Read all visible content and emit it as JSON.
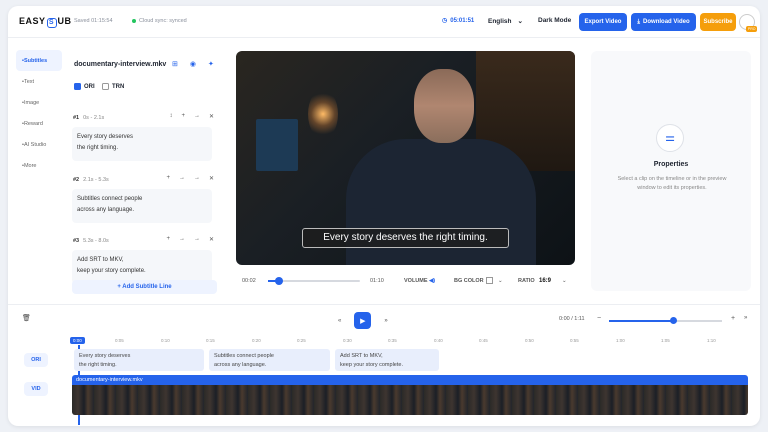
{
  "topbar": {
    "logo_left": "EASY",
    "logo_mark": "S",
    "logo_right": "UB",
    "saved": "Saved 01:15:54",
    "cloud": "Cloud sync: synced",
    "timer": "05:01:51",
    "language": "English",
    "dark_mode": "Dark Mode",
    "export": "Export Video",
    "download": "Download Video",
    "subscribe": "Subscribe",
    "avatar_badge": "PRO"
  },
  "sidebar": {
    "items": [
      {
        "label": "Subtitles"
      },
      {
        "label": "Text"
      },
      {
        "label": "Image"
      },
      {
        "label": "Reward"
      },
      {
        "label": "AI Studio"
      },
      {
        "label": "More"
      }
    ]
  },
  "panel": {
    "filename": "documentary-interview.mkv",
    "ori": "ORI",
    "trn": "TRN",
    "subs": [
      {
        "num": "#1",
        "time": "0s - 2.1s",
        "line1": "Every story deserves",
        "line2": "the right timing."
      },
      {
        "num": "#2",
        "time": "2.1s - 5.3s",
        "line1": "Subtitles connect people",
        "line2": "across any language."
      },
      {
        "num": "#3",
        "time": "5.3s - 8.0s",
        "line1": "Add SRT to MKV,",
        "line2": "keep your story complete."
      }
    ],
    "add_line": "+ Add Subtitle Line"
  },
  "video": {
    "caption": "Every story deserves the right timing."
  },
  "controls": {
    "current": "00:02",
    "duration": "01:10",
    "volume": "VOLUME",
    "bg_color": "BG COLOR",
    "ratio_label": "RATIO",
    "ratio_value": "16:9",
    "progress": 0.03
  },
  "properties": {
    "title": "Properties",
    "description": "Select a clip on the timeline or in the preview window to edit its properties."
  },
  "timeline": {
    "time": "0:00 / 1:11",
    "zoom": 0.58,
    "ruler": [
      "0:00",
      "0:05",
      "0:10",
      "0:15",
      "0:20",
      "0:25",
      "0:30",
      "0:35",
      "0:40",
      "0:45",
      "0:50",
      "0:55",
      "1:00",
      "1:05",
      "1:10"
    ],
    "ori_label": "ORI",
    "vid_label": "VID",
    "clips": [
      {
        "line1": "Every story deserves",
        "line2": "the right timing."
      },
      {
        "line1": "Subtitles connect people",
        "line2": "across any language."
      },
      {
        "line1": "Add SRT to MKV,",
        "line2": "keep your story complete."
      }
    ],
    "video_clip": "documentary-interview.mkv"
  },
  "colors": {
    "accent": "#2563eb",
    "subscribe": "#f59e0b"
  }
}
